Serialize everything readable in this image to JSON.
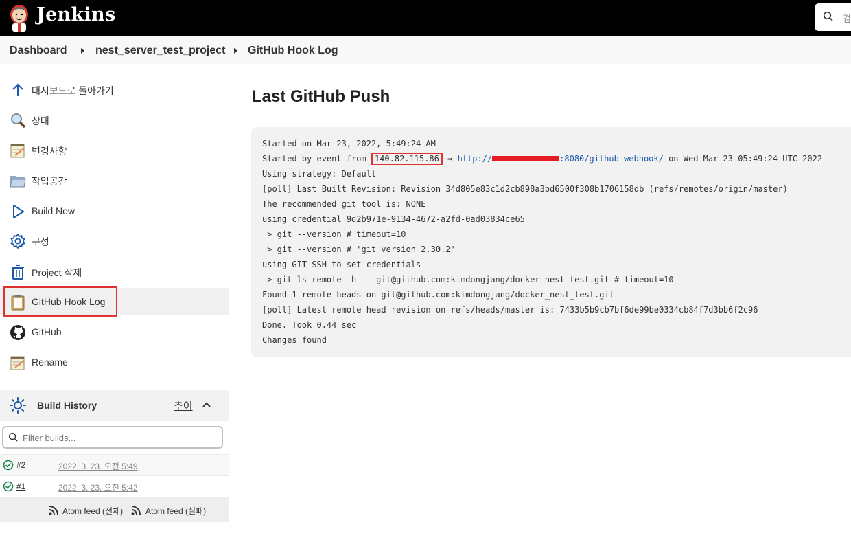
{
  "header": {
    "brand": "Jenkins",
    "search_hint": "검"
  },
  "breadcrumb": [
    "Dashboard",
    "nest_server_test_project",
    "GitHub Hook Log"
  ],
  "sidebar": {
    "tasks": [
      {
        "label": "대시보드로 돌아가기",
        "icon": "arrow-up-icon"
      },
      {
        "label": "상태",
        "icon": "magnifier-icon"
      },
      {
        "label": "변경사항",
        "icon": "notepad-icon"
      },
      {
        "label": "작업공간",
        "icon": "folder-icon"
      },
      {
        "label": "Build Now",
        "icon": "play-icon"
      },
      {
        "label": "구성",
        "icon": "gear-icon"
      },
      {
        "label": "Project 삭제",
        "icon": "trash-icon"
      },
      {
        "label": "GitHub Hook Log",
        "icon": "clipboard-icon",
        "active": true
      },
      {
        "label": "GitHub",
        "icon": "github-icon"
      },
      {
        "label": "Rename",
        "icon": "notepad-icon"
      }
    ],
    "build_history": {
      "title": "Build History",
      "trend_label": "추이",
      "filter_placeholder": "Filter builds...",
      "builds": [
        {
          "number": "#2",
          "date": "2022. 3. 23. 오전 5:49",
          "status": "success"
        },
        {
          "number": "#1",
          "date": "2022. 3. 23. 오전 5:42",
          "status": "success"
        }
      ],
      "feeds": [
        "Atom feed (전체)",
        "Atom feed (실패)"
      ]
    }
  },
  "main": {
    "title": "Last GitHub Push",
    "log": {
      "line1": "Started on Mar 23, 2022, 5:49:24 AM",
      "line2_prefix": "Started by event from ",
      "line2_ip": "140.82.115.86",
      "line2_arrow": " ⇒ ",
      "line2_url_start": "http://",
      "line2_url_end": ":8080/github-webhook/",
      "line2_suffix": " on Wed Mar 23 05:49:24 UTC 2022",
      "lines": [
        "Using strategy: Default",
        "[poll] Last Built Revision: Revision 34d805e83c1d2cb898a3bd6500f308b1706158db (refs/remotes/origin/master)",
        "The recommended git tool is: NONE",
        "using credential 9d2b971e-9134-4672-a2fd-0ad03834ce65",
        " > git --version # timeout=10",
        " > git --version # 'git version 2.30.2'",
        "using GIT_SSH to set credentials",
        " > git ls-remote -h -- git@github.com:kimdongjang/docker_nest_test.git # timeout=10",
        "Found 1 remote heads on git@github.com:kimdongjang/docker_nest_test.git",
        "[poll] Latest remote head revision on refs/heads/master is: 7433b5b9cb7bf6de99be0334cb84f7d3bb6f2c96",
        "Done. Took 0.44 sec",
        "Changes found"
      ]
    }
  },
  "colors": {
    "header_bg": "#000000",
    "highlight": "#dd3333",
    "link": "#1a5aa8",
    "success": "#138347"
  }
}
